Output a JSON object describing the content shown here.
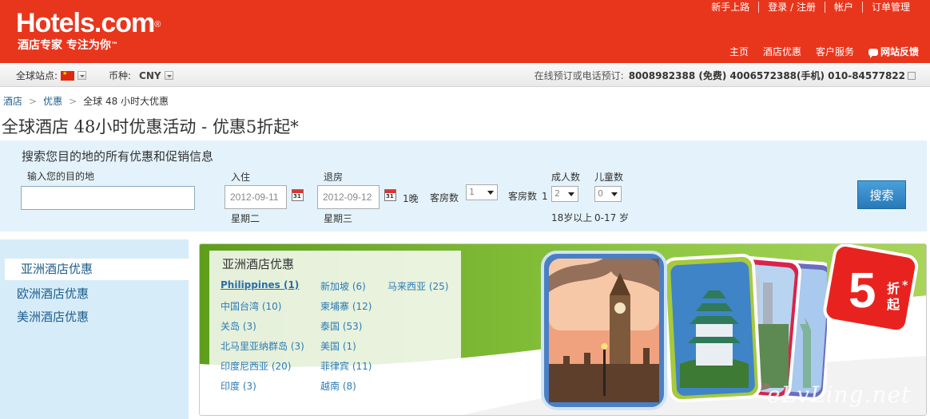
{
  "brand": {
    "logo_text": "Hotels.com",
    "logo_reg": "®",
    "tagline": "酒店专家 专注为你",
    "tagline_tm": "™",
    "color": "#e8361d"
  },
  "top_links": [
    "新手上路",
    "登录 / 注册",
    "帐户",
    "订单管理"
  ],
  "main_nav": {
    "home": "主页",
    "deals": "酒店优惠",
    "service": "客户服务",
    "feedback": "网站反馈"
  },
  "subbar": {
    "site_label": "全球站点:",
    "currency_label": "币种:",
    "currency_value": "CNY",
    "contact_label": "在线预订或电话预订:",
    "contact_phones": "8008982388 (免费) 4006572388(手机) 010-84577822"
  },
  "breadcrumb": {
    "home": "酒店",
    "deals": "优惠",
    "current": "全球 48 小时大优惠"
  },
  "page_title": "全球酒店  48小时优惠活动  - 优惠5折起*",
  "search": {
    "heading": "搜索您目的地的所有优惠和促销信息",
    "destination_label": "输入您的目的地",
    "destination_value": "",
    "checkin_label": "入住",
    "checkin_value": "2012-09-11",
    "checkin_day": "星期二",
    "checkout_label": "退房",
    "checkout_value": "2012-09-12",
    "checkout_day": "星期三",
    "calendar_icon_text": "31",
    "nights": "1晚",
    "rooms_label": "客房数",
    "rooms_value": "1",
    "room_index_label": "客房数",
    "room_index": "1",
    "adults_label": "成人数",
    "adults_value": "2",
    "adults_note": "18岁以上",
    "children_label": "儿童数",
    "children_value": "0",
    "children_note": "0-17 岁",
    "button": "搜索"
  },
  "regions": [
    "亚洲酒店优惠",
    "欧洲酒店优惠",
    "美洲酒店优惠"
  ],
  "promo": {
    "heading": "亚洲酒店优惠",
    "countries": [
      [
        "Philippines (1)",
        "中国台湾 (10)",
        "关岛 (3)",
        "北马里亚纳群岛 (3)",
        "印度尼西亚 (20)",
        "印度 (3)"
      ],
      [
        "新加坡 (6)",
        "柬埔寨 (12)",
        "泰国 (53)",
        "美国 (1)",
        "菲律宾 (11)",
        "越南 (8)"
      ],
      [
        "马来西亚 (25)"
      ]
    ],
    "badge_number": "5",
    "badge_text_1": "折",
    "badge_text_2": "起",
    "badge_star": "*"
  },
  "watermark": "eLvLing.net",
  "colors": {
    "header_red": "#e8361d",
    "link_blue": "#1f5d8f",
    "panel_blue": "#e4f3fb",
    "sidebar_blue": "#d6ecf8",
    "promo_green": "#8cc63f",
    "button_blue": "#2779b7"
  }
}
